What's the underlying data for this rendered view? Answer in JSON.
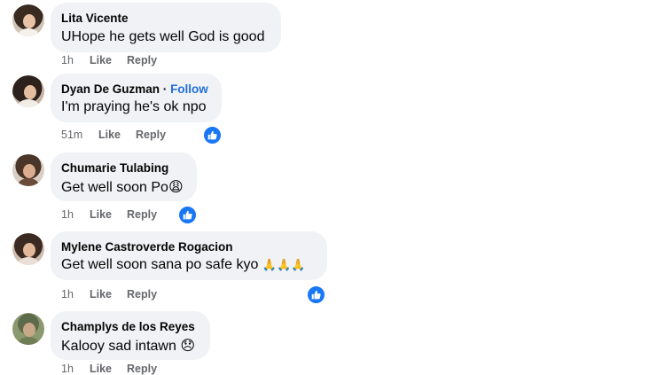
{
  "comments": [
    {
      "author": "Lita Vicente",
      "follow": "",
      "text": "UHope he gets well God is good",
      "emoji": "",
      "time": "1h",
      "like_label": "Like",
      "reply_label": "Reply",
      "has_reaction": false
    },
    {
      "author": "Dyan De Guzman",
      "follow": "Follow",
      "text": "I'm praying he's ok npo",
      "emoji": "",
      "time": "51m",
      "like_label": "Like",
      "reply_label": "Reply",
      "has_reaction": true,
      "reaction_icon": "thumbs-up-icon"
    },
    {
      "author": "Chumarie Tulabing",
      "follow": "",
      "text": "Get well soon Po",
      "emoji": "😩",
      "time": "1h",
      "like_label": "Like",
      "reply_label": "Reply",
      "has_reaction": true,
      "reaction_icon": "thumbs-up-icon"
    },
    {
      "author": "Mylene Castroverde Rogacion",
      "follow": "",
      "text": "Get well soon sana po safe kyo",
      "emoji": "🙏🙏🙏",
      "time": "1h",
      "like_label": "Like",
      "reply_label": "Reply",
      "has_reaction": true,
      "reaction_icon": "thumbs-up-icon"
    },
    {
      "author": "Champlys de los Reyes",
      "follow": "",
      "text": "Kalooy sad intawn",
      "emoji": "😞",
      "time": "1h",
      "like_label": "Like",
      "reply_label": "Reply",
      "has_reaction": false
    }
  ],
  "colors": {
    "bubble": "#f0f2f5",
    "link": "#216fdb",
    "meta": "#65676b",
    "reaction": "#1877f2"
  }
}
